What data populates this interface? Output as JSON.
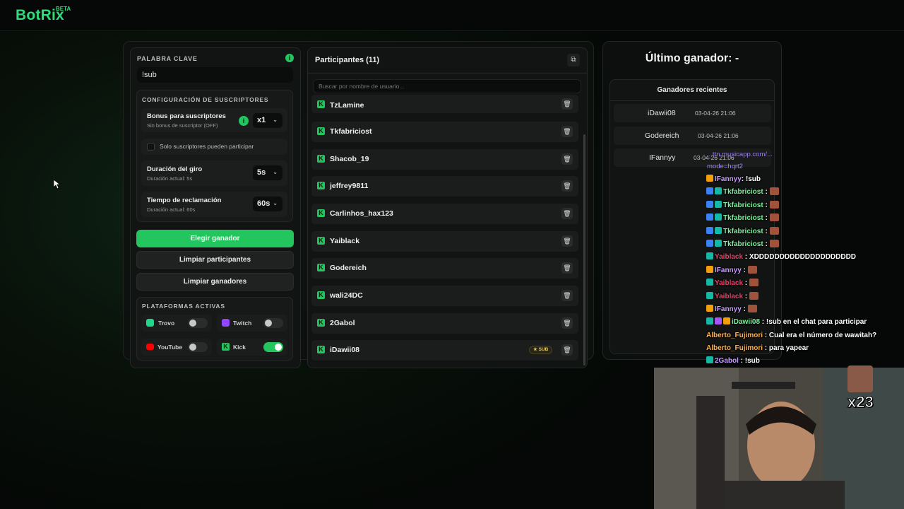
{
  "app": {
    "logo": "BotRix",
    "badge": "BETA"
  },
  "left": {
    "keyword_label": "PALABRA CLAVE",
    "keyword_value": "!sub",
    "subs_config_label": "CONFIGURACIÓN DE SUSCRIPTORES",
    "bonus_title": "Bonus para suscriptores",
    "bonus_sub": "Sin bonus de suscriptor (OFF)",
    "bonus_value": "x1",
    "only_subs_label": "Solo suscriptores pueden participar",
    "spin_title": "Duración del giro",
    "spin_sub": "Duración actual: 5s",
    "spin_value": "5s",
    "claim_title": "Tiempo de reclamación",
    "claim_sub": "Duración actual: 60s",
    "claim_value": "60s",
    "btn_pick": "Elegir ganador",
    "btn_clear_participants": "Limpiar participantes",
    "btn_clear_winners": "Limpiar ganadores",
    "platforms_label": "PLATAFORMAS ACTIVAS",
    "platforms": [
      {
        "name": "Trovo",
        "on": false
      },
      {
        "name": "Twitch",
        "on": false
      },
      {
        "name": "YouTube",
        "on": false
      },
      {
        "name": "Kick",
        "on": true
      }
    ]
  },
  "participants": {
    "title": "Participantes (11)",
    "search_placeholder": "Buscar por nombre de usuario...",
    "items": [
      {
        "name": "TzLamine"
      },
      {
        "name": "Tkfabriciost"
      },
      {
        "name": "Shacob_19"
      },
      {
        "name": "jeffrey9811"
      },
      {
        "name": "Carlinhos_hax123"
      },
      {
        "name": "Yaiblack"
      },
      {
        "name": "Godereich"
      },
      {
        "name": "wali24DC"
      },
      {
        "name": "2Gabol"
      },
      {
        "name": "iDawii08",
        "badge": "SUB"
      }
    ]
  },
  "winner": {
    "title": "Último ganador: -",
    "recent_label": "Ganadores recientes",
    "items": [
      {
        "name": "iDawii08",
        "date": "03-04-26 21:06"
      },
      {
        "name": "Godereich",
        "date": "03-04-26 21:06"
      },
      {
        "name": "IFannyy",
        "date": "03-04-26 21:06"
      }
    ]
  },
  "chat": {
    "partial_line_1": "...ttn.musicapp.com/...",
    "partial_line_2": "mode=hqrt2",
    "messages": [
      {
        "user": "IFannyy",
        "color": "#c59cff",
        "badges": [
          "b-gold"
        ],
        "text": ": !sub",
        "emote": false
      },
      {
        "user": "Tkfabriciost",
        "color": "#7cf29b",
        "badges": [
          "b-blue",
          "b-teal"
        ],
        "text": " :",
        "emote": true
      },
      {
        "user": "Tkfabriciost",
        "color": "#7cf29b",
        "badges": [
          "b-blue",
          "b-teal"
        ],
        "text": " :",
        "emote": true
      },
      {
        "user": "Tkfabriciost",
        "color": "#7cf29b",
        "badges": [
          "b-blue",
          "b-teal"
        ],
        "text": " :",
        "emote": true
      },
      {
        "user": "Tkfabriciost",
        "color": "#7cf29b",
        "badges": [
          "b-blue",
          "b-teal"
        ],
        "text": " :",
        "emote": true
      },
      {
        "user": "Tkfabriciost",
        "color": "#7cf29b",
        "badges": [
          "b-blue",
          "b-teal"
        ],
        "text": " :",
        "emote": true
      },
      {
        "user": "Yaiblack",
        "color": "#e8416b",
        "badges": [
          "b-teal"
        ],
        "text": " : XDDDDDDDDDDDDDDDDDDDD",
        "emote": false
      },
      {
        "user": "IFannyy",
        "color": "#c59cff",
        "badges": [
          "b-gold"
        ],
        "text": " :",
        "emote": true
      },
      {
        "user": "Yaiblack",
        "color": "#e8416b",
        "badges": [
          "b-teal"
        ],
        "text": " :",
        "emote": true
      },
      {
        "user": "Yaiblack",
        "color": "#e8416b",
        "badges": [
          "b-teal"
        ],
        "text": " :",
        "emote": true
      },
      {
        "user": "IFannyy",
        "color": "#c59cff",
        "badges": [
          "b-gold"
        ],
        "text": " :",
        "emote": true
      },
      {
        "user": "iDawii08",
        "color": "#7cf29b",
        "badges": [
          "b-teal",
          "b-ring",
          "b-gold"
        ],
        "text": " : !sub en el chat para participar",
        "emote": false
      },
      {
        "user": "Alberto_Fujimori",
        "color": "#f5b25a",
        "badges": [],
        "text": " : Cual era el número de wawitah?",
        "emote": false
      },
      {
        "user": "Alberto_Fujimori",
        "color": "#f5b25a",
        "badges": [],
        "text": " : para yapear",
        "emote": false
      },
      {
        "user": "2Gabol",
        "color": "#c59cff",
        "badges": [
          "b-teal"
        ],
        "text": " : !sub",
        "emote": false
      }
    ]
  },
  "overlay": {
    "counter": "x23"
  }
}
